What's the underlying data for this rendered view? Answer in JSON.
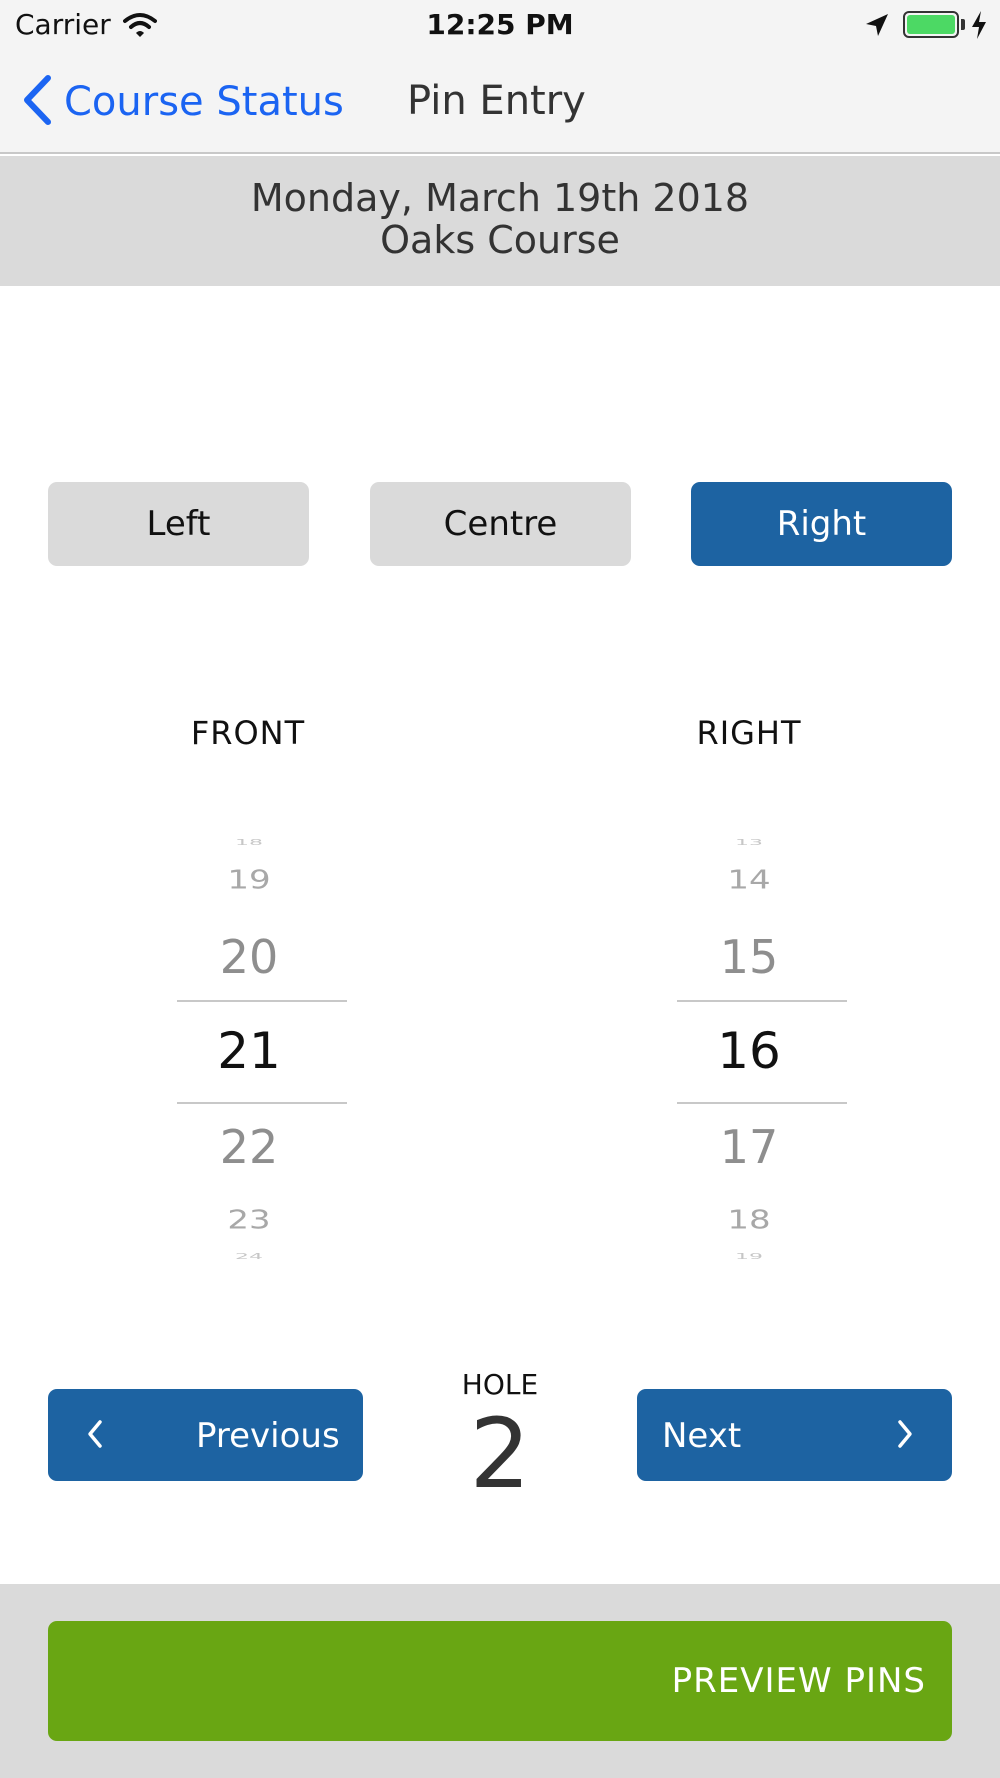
{
  "status_bar": {
    "carrier": "Carrier",
    "time": "12:25 PM",
    "icons": [
      "wifi-icon",
      "location-arrow-icon",
      "battery-icon",
      "charging-bolt-icon"
    ],
    "battery_level": 1.0,
    "battery_color": "#4cd964"
  },
  "nav": {
    "back_label": "Course Status",
    "title": "Pin Entry",
    "back_icon": "chevron-left-icon",
    "accent": "#1b64f2"
  },
  "header": {
    "date": "Monday, March 19th 2018",
    "course": "Oaks Course"
  },
  "position_selector": {
    "options": [
      "Left",
      "Centre",
      "Right"
    ],
    "selected": "Right",
    "selected_color": "#1d63a2"
  },
  "pickers": {
    "front": {
      "label": "FRONT",
      "values": [
        "18",
        "19",
        "20",
        "21",
        "22",
        "23",
        "24"
      ],
      "selected": "21"
    },
    "right": {
      "label": "RIGHT",
      "values": [
        "13",
        "14",
        "15",
        "16",
        "17",
        "18",
        "19"
      ],
      "selected": "16"
    }
  },
  "hole_nav": {
    "previous_label": "Previous",
    "next_label": "Next",
    "caption": "HOLE",
    "number": "2"
  },
  "footer": {
    "preview_label": "PREVIEW PINS",
    "preview_color": "#69a613"
  }
}
